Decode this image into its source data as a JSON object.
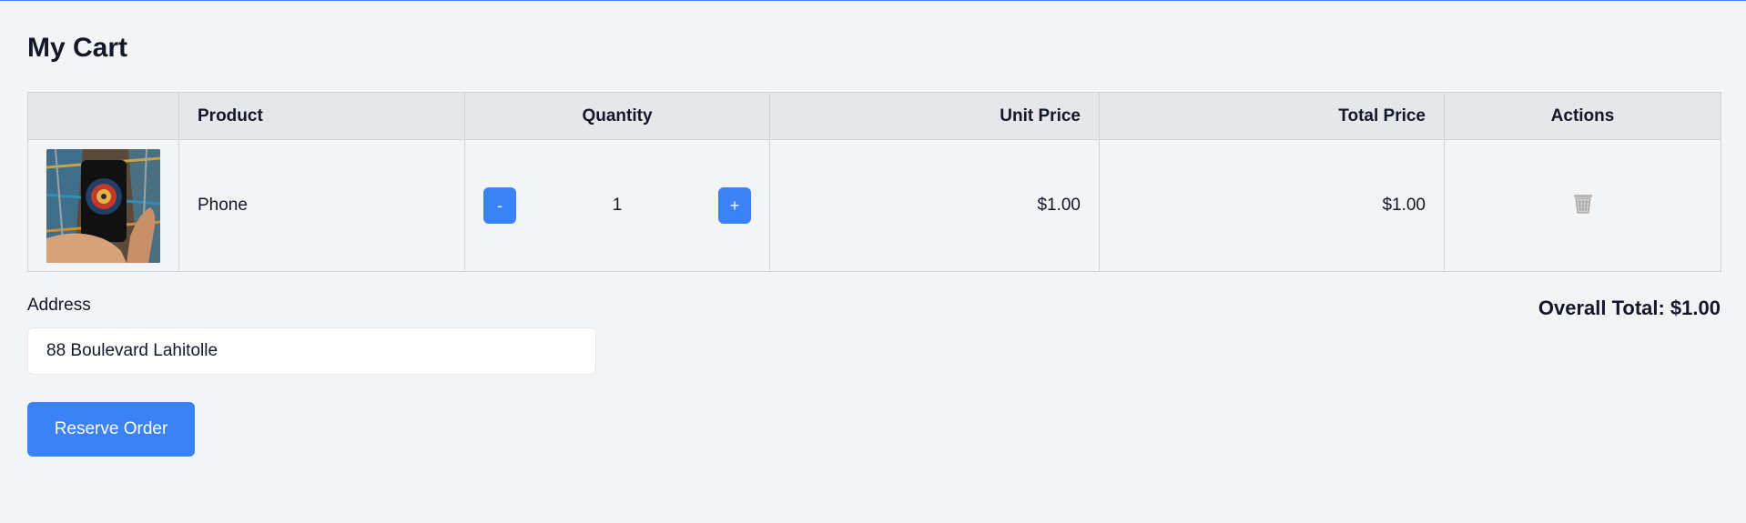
{
  "page": {
    "title": "My Cart"
  },
  "table": {
    "headers": {
      "image": "",
      "product": "Product",
      "quantity": "Quantity",
      "unit_price": "Unit Price",
      "total_price": "Total Price",
      "actions": "Actions"
    },
    "rows": [
      {
        "product": "Phone",
        "quantity": "1",
        "decrement_label": "-",
        "increment_label": "+",
        "unit_price": "$1.00",
        "total_price": "$1.00",
        "image_icon": "phone-product-image",
        "action_icon": "trash-icon"
      }
    ]
  },
  "address": {
    "label": "Address",
    "value": "88 Boulevard Lahitolle"
  },
  "summary": {
    "overall_total": "Overall Total: $1.00"
  },
  "actions": {
    "reserve_label": "Reserve Order"
  },
  "colors": {
    "accent": "#3b82f6",
    "background": "#f3f4f6",
    "header_bg": "#e5e7eb"
  }
}
